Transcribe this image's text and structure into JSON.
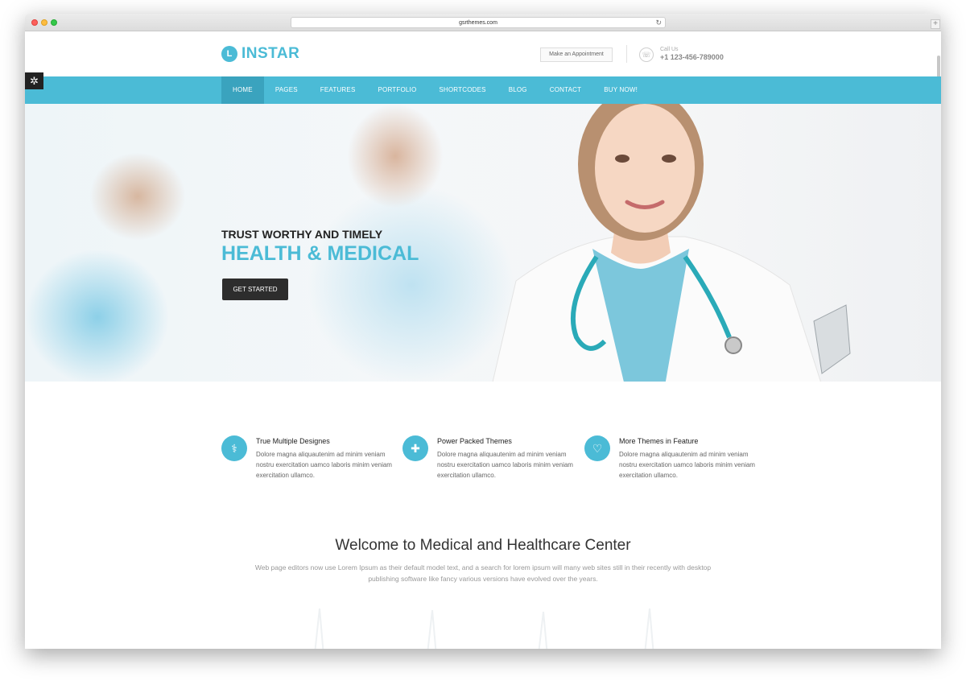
{
  "browser": {
    "url": "gsrthemes.com",
    "reload_icon": "↻",
    "new_tab_icon": "+"
  },
  "header": {
    "logo_mark": "L",
    "logo_text": "INSTAR",
    "appointment_label": "Make an Appointment",
    "call_label": "Call Us",
    "phone_number": "+1 123-456-789000",
    "phone_icon": "☏"
  },
  "settings": {
    "icon": "✲"
  },
  "nav": {
    "items": [
      {
        "label": "HOME"
      },
      {
        "label": "PAGES"
      },
      {
        "label": "FEATURES"
      },
      {
        "label": "PORTFOLIO"
      },
      {
        "label": "SHORTCODES"
      },
      {
        "label": "BLOG"
      },
      {
        "label": "CONTACT"
      },
      {
        "label": "BUY NOW!"
      }
    ]
  },
  "hero": {
    "tagline": "TRUST WORTHY AND TIMELY",
    "title": "HEALTH & MEDICAL",
    "cta_label": "GET STARTED"
  },
  "features": [
    {
      "icon": "stethoscope-icon",
      "glyph": "⚕",
      "title": "True Multiple Designes",
      "text": "Dolore magna aliquautenim ad minim veniam nostru exercitation uamco laboris minim veniam exercitation ullamco."
    },
    {
      "icon": "medkit-icon",
      "glyph": "✚",
      "title": "Power Packed Themes",
      "text": "Dolore magna aliquautenim ad minim veniam nostru exercitation uamco laboris minim veniam exercitation ullamco."
    },
    {
      "icon": "heart-icon",
      "glyph": "♡",
      "title": "More Themes in Feature",
      "text": "Dolore magna aliquautenim ad minim veniam nostru exercitation uamco laboris minim veniam exercitation ullamco."
    }
  ],
  "welcome": {
    "title": "Welcome to Medical and Healthcare Center",
    "text": "Web page editors now use Lorem Ipsum as their default model text, and a search for lorem ipsum will many web sites still in their recently with desktop publishing software like fancy various versions have evolved over the years."
  },
  "colors": {
    "accent": "#4bbbd6",
    "accent_dark": "#3aa3be",
    "cta": "#2d2d2d"
  }
}
